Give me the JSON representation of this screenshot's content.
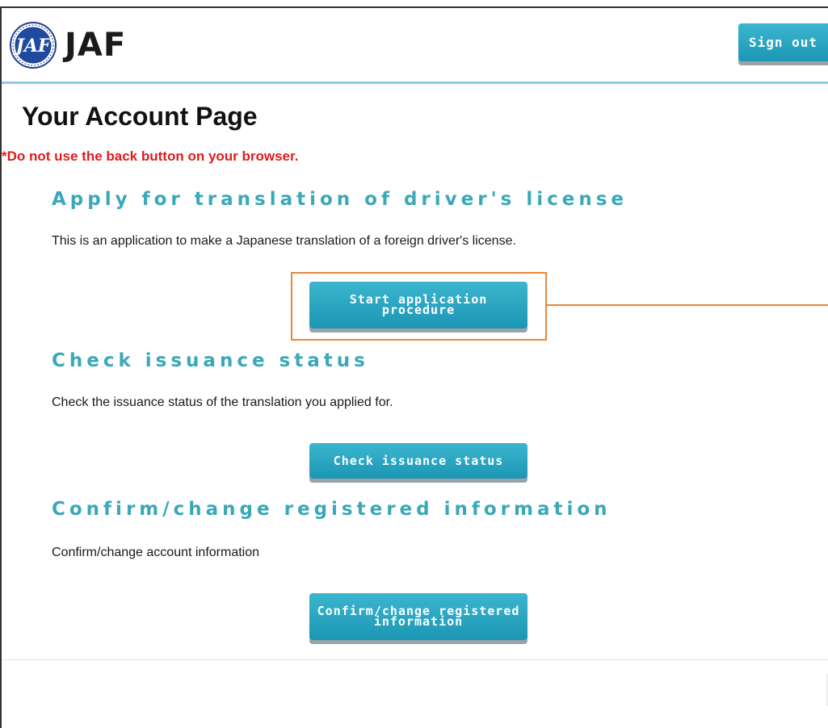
{
  "header": {
    "logo_text": "JAF",
    "signout_label": "Sign out"
  },
  "page_title": "Your Account Page",
  "warning": "*Do not use the back button on your browser.",
  "sections": [
    {
      "title": "Apply for translation of driver's license",
      "description": "This is an application to make a Japanese translation of a foreign driver's license.",
      "button_label": "Start application procedure"
    },
    {
      "title": "Check issuance status",
      "description": "Check the issuance status of the translation you applied for.",
      "button_label": "Check issuance status"
    },
    {
      "title": "Confirm/change registered information",
      "description": "Confirm/change account information",
      "button_label": "Confirm/change registered information"
    }
  ],
  "colors": {
    "accent": "#3aa8b8",
    "button": "#1b96b4",
    "warning": "#e11b1b",
    "highlight": "#e8873a",
    "header_line": "#8ec9ea"
  },
  "icons": {
    "logo": "jaf-emblem-icon"
  }
}
